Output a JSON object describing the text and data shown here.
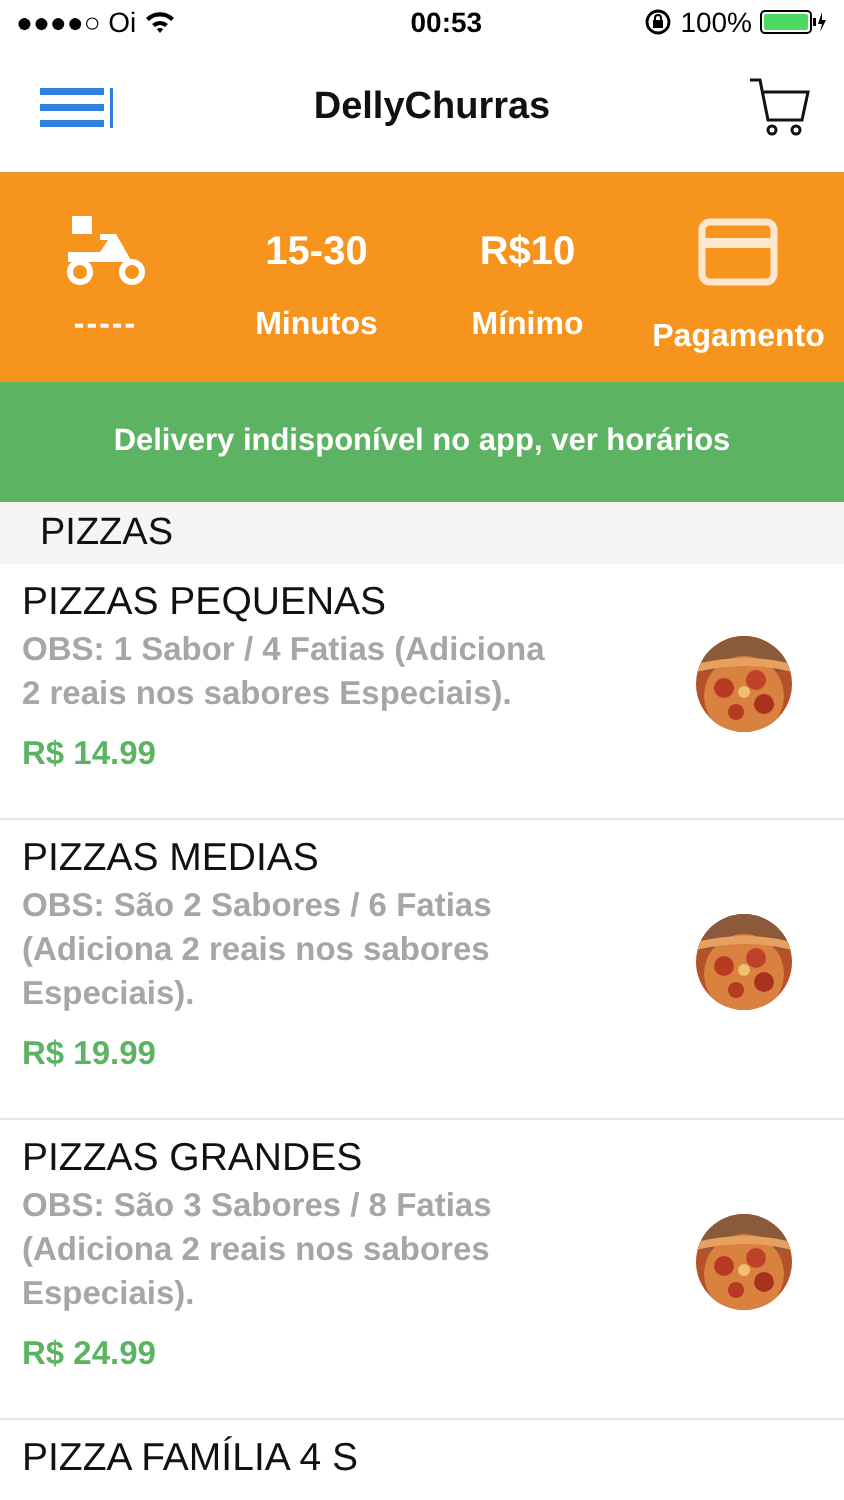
{
  "status_bar": {
    "carrier": "●●●●○ Oi",
    "time": "00:53",
    "battery": "100%"
  },
  "nav": {
    "title": "DellyChurras"
  },
  "info": [
    {
      "kind": "icon",
      "label": "-----"
    },
    {
      "kind": "value",
      "value": "15-30",
      "label": "Minutos"
    },
    {
      "kind": "value",
      "value": "R$10",
      "label": "Mínimo"
    },
    {
      "kind": "icon",
      "label": "Pagamento"
    }
  ],
  "notice": "Delivery indisponível no app, ver horários",
  "section": "PIZZAS",
  "items": [
    {
      "name": "PIZZAS PEQUENAS",
      "description": "OBS: 1 Sabor / 4 Fatias (Adiciona 2 reais nos sabores Especiais).",
      "price": "R$ 14.99"
    },
    {
      "name": "PIZZAS MEDIAS",
      "description": "OBS: São 2 Sabores / 6 Fatias (Adiciona 2 reais nos sabores Especiais).",
      "price": "R$ 19.99"
    },
    {
      "name": "PIZZAS GRANDES",
      "description": "OBS: São 3 Sabores / 8 Fatias (Adiciona 2 reais nos sabores Especiais).",
      "price": "R$ 24.99"
    },
    {
      "name": "PIZZA FAMÍLIA 4 S"
    }
  ]
}
